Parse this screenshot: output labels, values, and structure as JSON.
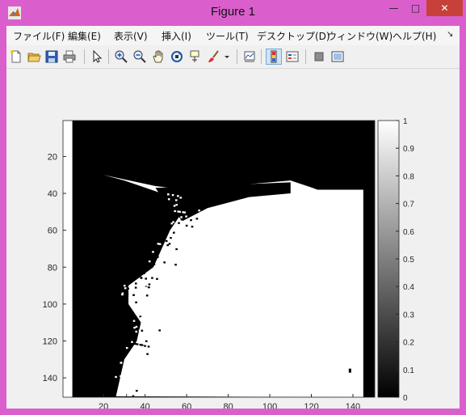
{
  "window": {
    "title": "Figure 1",
    "minimize": "—",
    "maximize": "□",
    "close": "✕"
  },
  "menus": [
    "ファイル(F)",
    "編集(E)",
    "表示(V)",
    "挿入(I)",
    "ツール(T)",
    "デスクトップ(D)",
    "ウィンドウ(W)",
    "ヘルプ(H)"
  ],
  "menu_overflow": "↘",
  "toolbar": [
    "new-figure-icon",
    "open-file-icon",
    "save-icon",
    "print-icon",
    "pointer-icon",
    "zoom-in-icon",
    "zoom-out-icon",
    "pan-hand-icon",
    "rotate-3d-icon",
    "data-cursor-icon",
    "brush-icon",
    "brush-dropdown-icon",
    "link-plot-icon",
    "colorbar-icon",
    "legend-icon",
    "hide-plot-tools-icon",
    "show-plot-tools-icon"
  ],
  "chart_data": {
    "type": "heatmap",
    "colormap": "gray",
    "xlim": [
      0.5,
      150.5
    ],
    "ylim": [
      0.5,
      150.5
    ],
    "xticks": [
      20,
      40,
      60,
      80,
      100,
      120,
      140
    ],
    "yticks": [
      20,
      40,
      60,
      80,
      100,
      120,
      140
    ],
    "colorbar": {
      "ticks": [
        0,
        0.1,
        0.2,
        0.3,
        0.4,
        0.5,
        0.6,
        0.7,
        0.8,
        0.9,
        1
      ]
    },
    "description_values": "binary mask: 0 = black, 1 = white",
    "black_columns_left_edge": 5,
    "white_region_boundary": [
      [
        20,
        30
      ],
      [
        45,
        36
      ],
      [
        60,
        38
      ],
      [
        75,
        42
      ],
      [
        90,
        35
      ],
      [
        110,
        33
      ],
      [
        118,
        36
      ],
      [
        123,
        38
      ],
      [
        145,
        38
      ]
    ],
    "white_region_left_edge_by_row": [
      [
        33,
        30
      ],
      [
        40,
        48
      ],
      [
        50,
        58
      ],
      [
        60,
        52
      ],
      [
        70,
        48
      ],
      [
        80,
        44
      ],
      [
        90,
        32
      ],
      [
        100,
        32
      ],
      [
        110,
        38
      ],
      [
        120,
        36
      ],
      [
        130,
        30
      ],
      [
        140,
        28
      ],
      [
        150,
        26
      ]
    ]
  }
}
